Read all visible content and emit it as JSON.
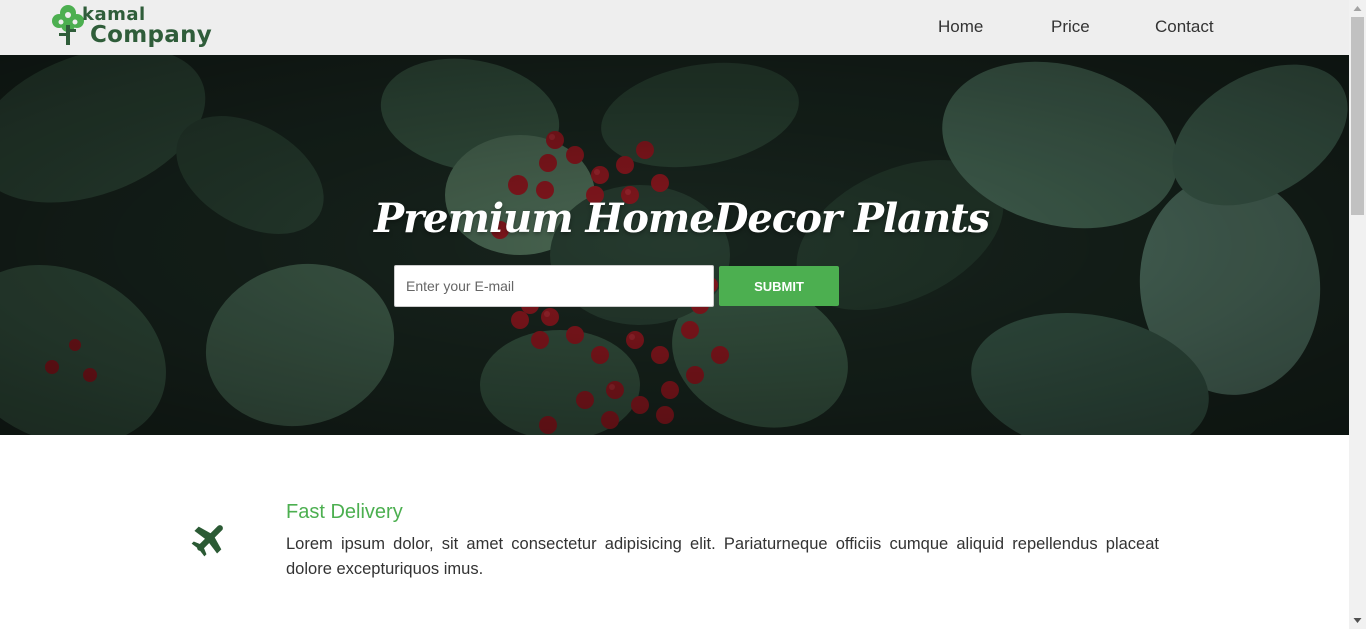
{
  "header": {
    "logo": {
      "line1": "kamal",
      "line2": "Company"
    },
    "nav": [
      {
        "label": "Home"
      },
      {
        "label": "Price"
      },
      {
        "label": "Contact"
      }
    ]
  },
  "hero": {
    "title": "Premium HomeDecor Plants",
    "email_placeholder": "Enter your E-mail",
    "submit_label": "SUBMIT"
  },
  "features": [
    {
      "icon": "airplane-icon",
      "title": "Fast Delivery",
      "text": "Lorem ipsum dolor, sit amet consectetur adipisicing elit. Pariaturneque officiis cumque aliquid repellendus placeat dolore excepturiquos imus."
    }
  ],
  "colors": {
    "accent": "#4caf50",
    "logo": "#2f5d3a",
    "header_bg": "#eeeeee",
    "icon_dark": "#2b5a34"
  }
}
